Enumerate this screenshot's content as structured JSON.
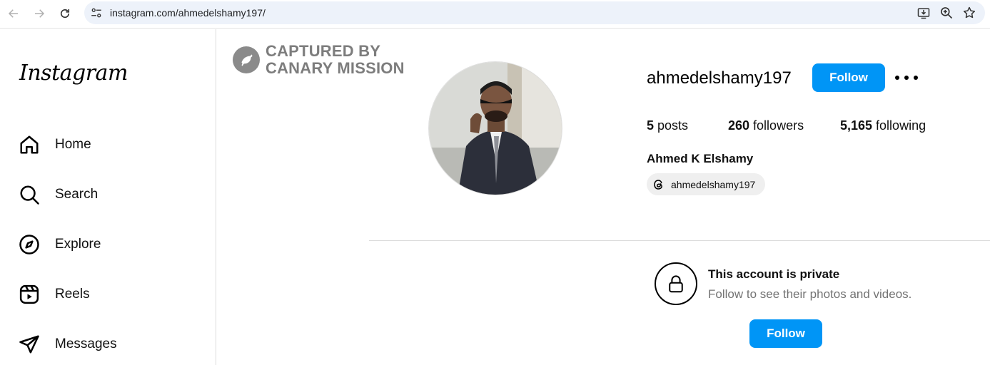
{
  "browser": {
    "url": "instagram.com/ahmedelshamy197/",
    "icons": [
      "back-arrow-icon",
      "forward-arrow-icon",
      "reload-icon",
      "site-settings-icon",
      "install-app-icon",
      "zoom-icon",
      "bookmark-star-icon"
    ]
  },
  "sidebar": {
    "logo": "Instagram",
    "items": [
      {
        "label": "Home",
        "icon": "home-icon"
      },
      {
        "label": "Search",
        "icon": "search-icon"
      },
      {
        "label": "Explore",
        "icon": "compass-icon"
      },
      {
        "label": "Reels",
        "icon": "reels-icon"
      },
      {
        "label": "Messages",
        "icon": "messages-icon"
      }
    ]
  },
  "watermark": {
    "line1": "CAPTURED BY",
    "line2": "CANARY MISSION"
  },
  "profile": {
    "username": "ahmedelshamy197",
    "follow_label": "Follow",
    "posts_count": "5",
    "posts_label": " posts",
    "followers_count": "260",
    "followers_label": " followers",
    "following_count": "5,165",
    "following_label": " following",
    "full_name": "Ahmed K Elshamy",
    "threads_handle": "ahmedelshamy197"
  },
  "private_notice": {
    "title": "This account is private",
    "subtitle": "Follow to see their photos and videos.",
    "follow_label": "Follow"
  },
  "colors": {
    "accent": "#0095f6",
    "border": "#dbdbdb",
    "muted_text": "#737373",
    "url_bar": "#edf2fa"
  }
}
